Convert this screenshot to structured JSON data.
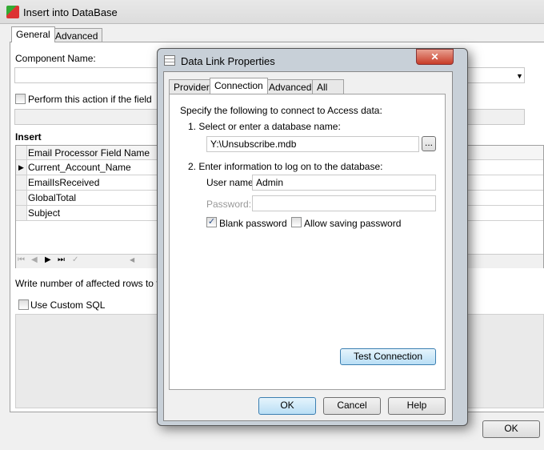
{
  "main": {
    "title": "Insert into DataBase",
    "tabs": [
      "General",
      "Advanced"
    ],
    "component_name_label": "Component Name:",
    "component_name_value": "",
    "perform_label": "Perform this action if the field",
    "insert_label": "Insert",
    "grid": {
      "header": "Email Processor Field Name",
      "rows": [
        "Current_Account_Name",
        "EmailIsReceived",
        "GlobalTotal",
        "Subject"
      ]
    },
    "nav_buttons": [
      "first",
      "prev",
      "next",
      "last",
      "post"
    ],
    "write_rows_label": "Write number of affected rows to the",
    "custom_sql_label": "Use Custom SQL",
    "ok": "OK"
  },
  "dialog": {
    "title": "Data Link Properties",
    "tabs": [
      "Provider",
      "Connection",
      "Advanced",
      "All"
    ],
    "intro": "Specify the following to connect to Access data:",
    "step1": "1. Select or enter a database name:",
    "db_name": "Y:\\Unsubscribe.mdb",
    "browse": "...",
    "step2": "2. Enter information to log on to the database:",
    "user_label": "User name:",
    "user_value": "Admin",
    "password_label": "Password:",
    "password_value": "",
    "blank_password": "Blank password",
    "blank_password_checked": true,
    "allow_saving": "Allow saving password",
    "allow_saving_checked": false,
    "test_connection": "Test Connection",
    "ok": "OK",
    "cancel": "Cancel",
    "help": "Help"
  }
}
